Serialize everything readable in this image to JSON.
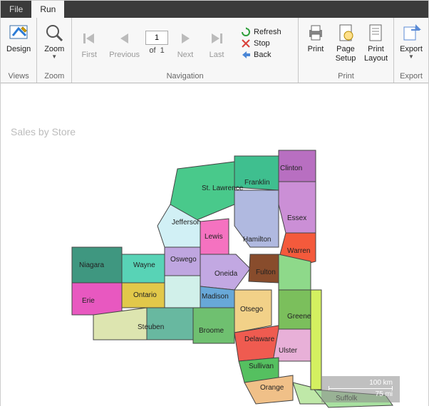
{
  "tabs": {
    "file": "File",
    "run": "Run"
  },
  "ribbon": {
    "views": {
      "design": "Design",
      "group": "Views"
    },
    "zoom": {
      "zoom": "Zoom",
      "group": "Zoom"
    },
    "nav": {
      "first": "First",
      "previous": "Previous",
      "next": "Next",
      "last": "Last",
      "of": "of",
      "page": "1",
      "total": "1",
      "refresh": "Refresh",
      "stop": "Stop",
      "back": "Back",
      "group": "Navigation"
    },
    "print": {
      "print": "Print",
      "pageSetup": "Page\nSetup",
      "layout": "Print\nLayout",
      "group": "Print"
    },
    "export": {
      "export": "Export",
      "group": "Export"
    }
  },
  "report": {
    "title": "Sales by Store",
    "scale_km": "100 km",
    "scale_mi": "75 mi"
  },
  "counties": {
    "clinton": "Clinton",
    "franklin": "Franklin",
    "stlawrence": "St. Lawrence",
    "jefferson": "Jefferson",
    "lewis": "Lewis",
    "essex": "Essex",
    "hamilton": "Hamilton",
    "warren": "Warren",
    "oswego": "Oswego",
    "oneida": "Oneida",
    "fulton": "Fulton",
    "madison": "Madison",
    "wayne": "Wayne",
    "niagara": "Niagara",
    "ontario": "Ontario",
    "erie": "Erie",
    "steuben": "Steuben",
    "broome": "Broome",
    "otsego": "Otsego",
    "delaware": "Delaware",
    "greene": "Greene",
    "ulster": "Ulster",
    "sullivan": "Sullivan",
    "orange": "Orange",
    "suffolk": "Suffolk"
  }
}
